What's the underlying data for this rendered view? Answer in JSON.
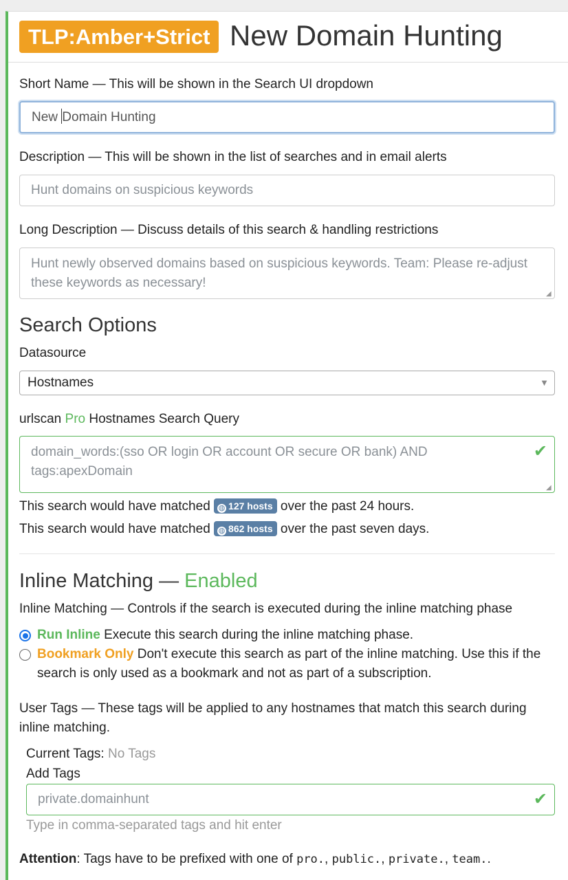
{
  "header": {
    "tlp_badge": "TLP:Amber+Strict",
    "title": "New Domain Hunting"
  },
  "short_name": {
    "label": "Short Name — This will be shown in the Search UI dropdown",
    "value_before_caret": "New ",
    "value_after_caret": "Domain Hunting"
  },
  "description": {
    "label": "Description — This will be shown in the list of searches and in email alerts",
    "placeholder": "Hunt domains on suspicious keywords"
  },
  "long_description": {
    "label": "Long Description — Discuss details of this search & handling restrictions",
    "placeholder": "Hunt newly observed domains based on suspicious keywords. Team: Please re-adjust these keywords as necessary!"
  },
  "search_options": {
    "heading": "Search Options",
    "datasource_label": "Datasource",
    "datasource_value": "Hostnames",
    "query_label_prefix": "urlscan ",
    "query_label_pro": "Pro",
    "query_label_suffix": " Hostnames Search Query",
    "query_value": "domain_words:(sso OR login OR account OR secure OR bank) AND tags:apexDomain",
    "match_line_prefix": "This search would have matched ",
    "match_24h_badge": "127 hosts",
    "match_24h_suffix": " over the past 24 hours.",
    "match_7d_badge": "862 hosts",
    "match_7d_suffix": " over the past seven days."
  },
  "inline_matching": {
    "heading_prefix": "Inline Matching — ",
    "heading_status": "Enabled",
    "label": "Inline Matching — Controls if the search is executed during the inline matching phase",
    "options": [
      {
        "title": "Run Inline",
        "text": " Execute this search during the inline matching phase."
      },
      {
        "title": "Bookmark Only",
        "text": " Don't execute this search as part of the inline matching. Use this if the search is only used as a bookmark and not as part of a subscription."
      }
    ]
  },
  "user_tags": {
    "label": "User Tags — These tags will be applied to any hostnames that match this search during inline matching.",
    "current_label": "Current Tags: ",
    "current_value": "No Tags",
    "add_label": "Add Tags",
    "input_value": "private.domainhunt",
    "help": "Type in comma-separated tags and hit enter",
    "attention_label": "Attention",
    "attention_text": ": Tags have to be prefixed with one of ",
    "prefixes": [
      "pro.",
      "public.",
      "private.",
      "team."
    ]
  },
  "colors": {
    "tlp_amber": "#f0a022",
    "enabled_green": "#5cb85c",
    "badge_blue": "#5a7fa5"
  }
}
